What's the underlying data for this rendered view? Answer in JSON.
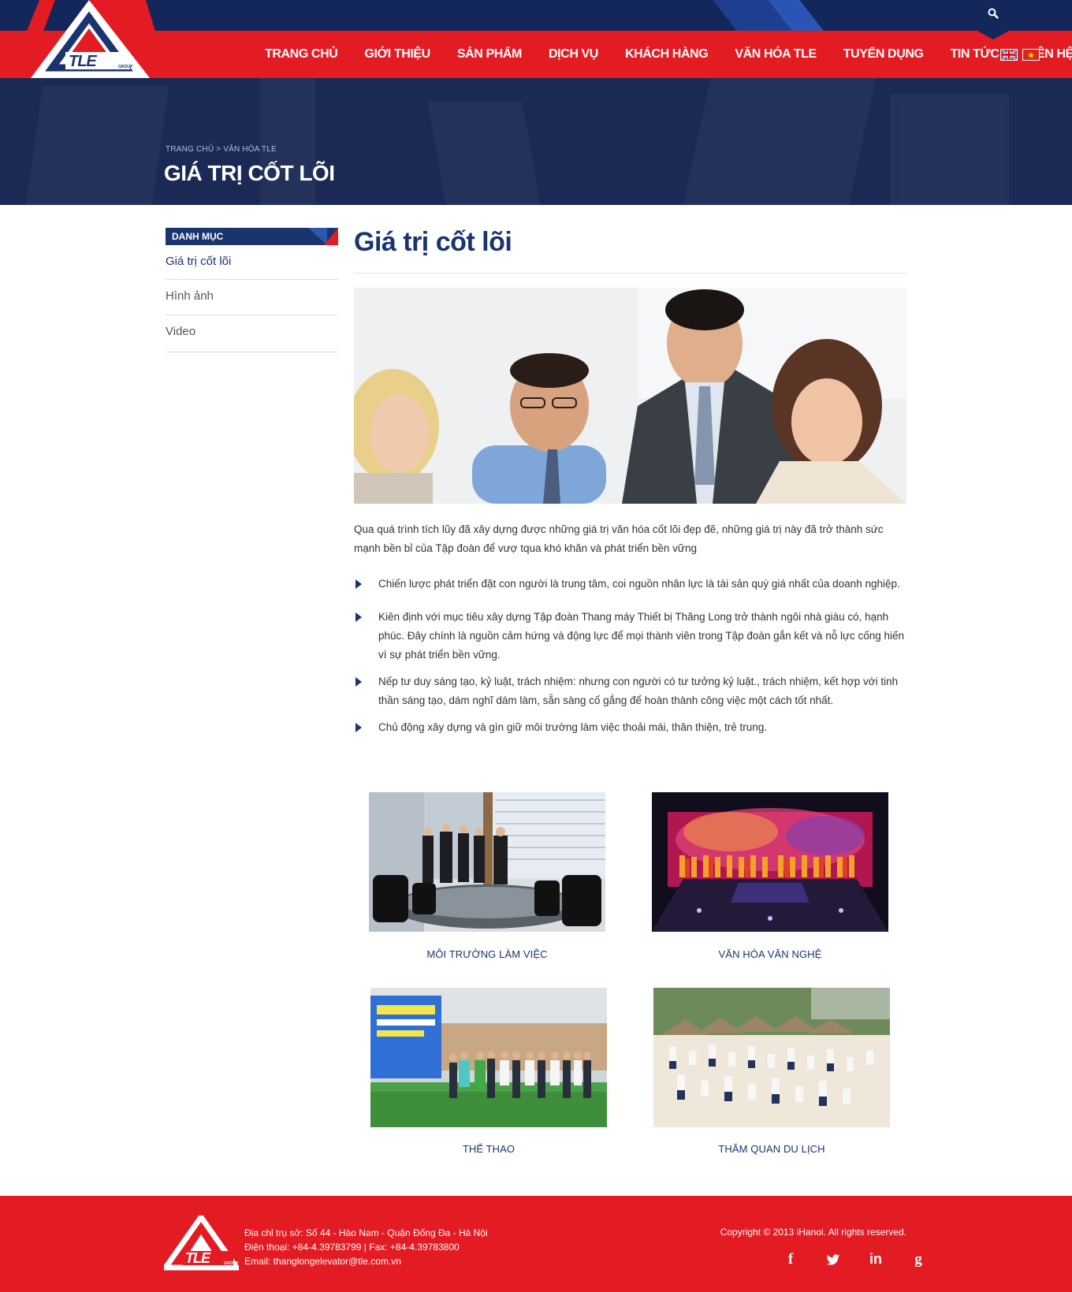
{
  "header": {
    "logo_text": "TLE",
    "logo_sub": "GROUP",
    "nav": [
      "TRANG CHỦ",
      "GIỚI THIỆU",
      "SẢN PHẨM",
      "DỊCH VỤ",
      "KHÁCH HÀNG",
      "VĂN HÓA TLE",
      "TUYỂN DỤNG",
      "TIN TỨC",
      "LIÊN HỆ"
    ],
    "search_icon": "search-icon",
    "flags": [
      "uk-flag-icon",
      "vietnam-flag-icon"
    ]
  },
  "banner": {
    "breadcrumb": "TRANG CHỦ > VĂN HÓA TLE",
    "title": "GIÁ TRỊ CỐT LÕI"
  },
  "sidebar": {
    "heading": "DANH MỤC",
    "items": [
      "Giá trị cốt lõi",
      "Hình ảnh",
      "Video"
    ]
  },
  "main": {
    "title": "Giá trị cốt lõi",
    "intro": "Qua quá trình tích lũy đã xây dựng được những giá trị văn hóa cốt lõi đẹp đẽ, những giá trị này đã trở thành sức mạnh bền bỉ của Tập đoàn để vượ tqua khó khăn và phát triển bền vững",
    "bullets": [
      "Chiến lược phát triển đặt con người là trung tâm, coi nguồn nhân lực là tài sản quý giá nhất của doanh nghiệp.",
      "Kiên định với mục tiêu xây dựng Tập đoàn Thang máy Thiết bị Thăng Long trở thành ngôi nhà giàu có, hạnh phúc. Đây chính là nguồn cảm hứng và động lực để mọi thành viên trong Tập đoàn gắn kết và nỗ lực cống hiến vì sự phát triển bền vững.",
      "Nếp tư duy sáng tạo, kỷ luật, trách nhiệm: nhưng con người có tư tưởng kỷ luật., trách nhiệm, kết hợp với tinh thần sáng tạo, dám nghĩ dám làm, sẵn sàng cố gắng để hoàn thành công việc một cách tốt nhất.",
      "Chủ động xây dựng và gìn giữ môi trường làm việc thoải mái, thân thiện, trẻ trung."
    ],
    "gallery": [
      "MÔI TRƯỜNG LÀM VIỆC",
      "VĂN HÓA VĂN NGHỆ",
      "THỂ THAO",
      "THĂM QUAN DU LỊCH"
    ]
  },
  "footer": {
    "address": "Địa chỉ trụ sở: Số 44 - Hào Nam - Quận Đống Đa - Hà Nội",
    "phone": "Điện thoại:  +84-4.39783799  |  Fax: +84-4.39783800",
    "email": "Email: thanglongelevator@tle.com.vn",
    "copyright": "Copyright © 2013 iHanoi. All rights reserved.",
    "social": [
      "f",
      "twitter",
      "in",
      "g"
    ]
  }
}
